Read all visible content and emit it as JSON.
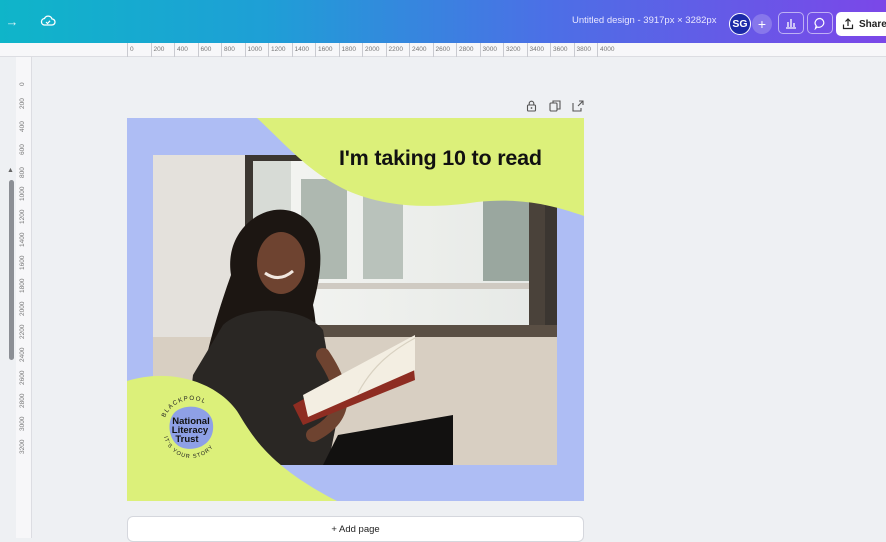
{
  "header": {
    "doc_title": "Untitled design - 3917px × 3282px",
    "avatar_initials": "SG",
    "plus_label": "+",
    "share_label": "Share"
  },
  "rulers": {
    "top_ticks": [
      "0",
      "200",
      "400",
      "600",
      "800",
      "1000",
      "1200",
      "1400",
      "1600",
      "1800",
      "2000",
      "2200",
      "2400",
      "2600",
      "2800",
      "3000",
      "3200",
      "3400",
      "3600",
      "3800",
      "4000"
    ],
    "left_ticks": [
      "0",
      "200",
      "400",
      "600",
      "800",
      "1000",
      "1200",
      "1400",
      "1600",
      "1800",
      "2000",
      "2200",
      "2400",
      "2600",
      "2800",
      "3000",
      "3200"
    ]
  },
  "design": {
    "headline": "I'm taking 10 to read",
    "logo_name_line1": "National",
    "logo_name_line2": "Literacy",
    "logo_name_line3": "Trust",
    "logo_ring_top": "BLACKPOOL",
    "logo_ring_bottom": "IT'S YOUR STORY"
  },
  "footer": {
    "add_page_label": "+ Add page"
  },
  "colors": {
    "accent_lime": "#dcf07a",
    "accent_periwinkle": "#aebdf4",
    "logo_blob": "#8ea0e6",
    "avatar": "#1c2aa8"
  }
}
